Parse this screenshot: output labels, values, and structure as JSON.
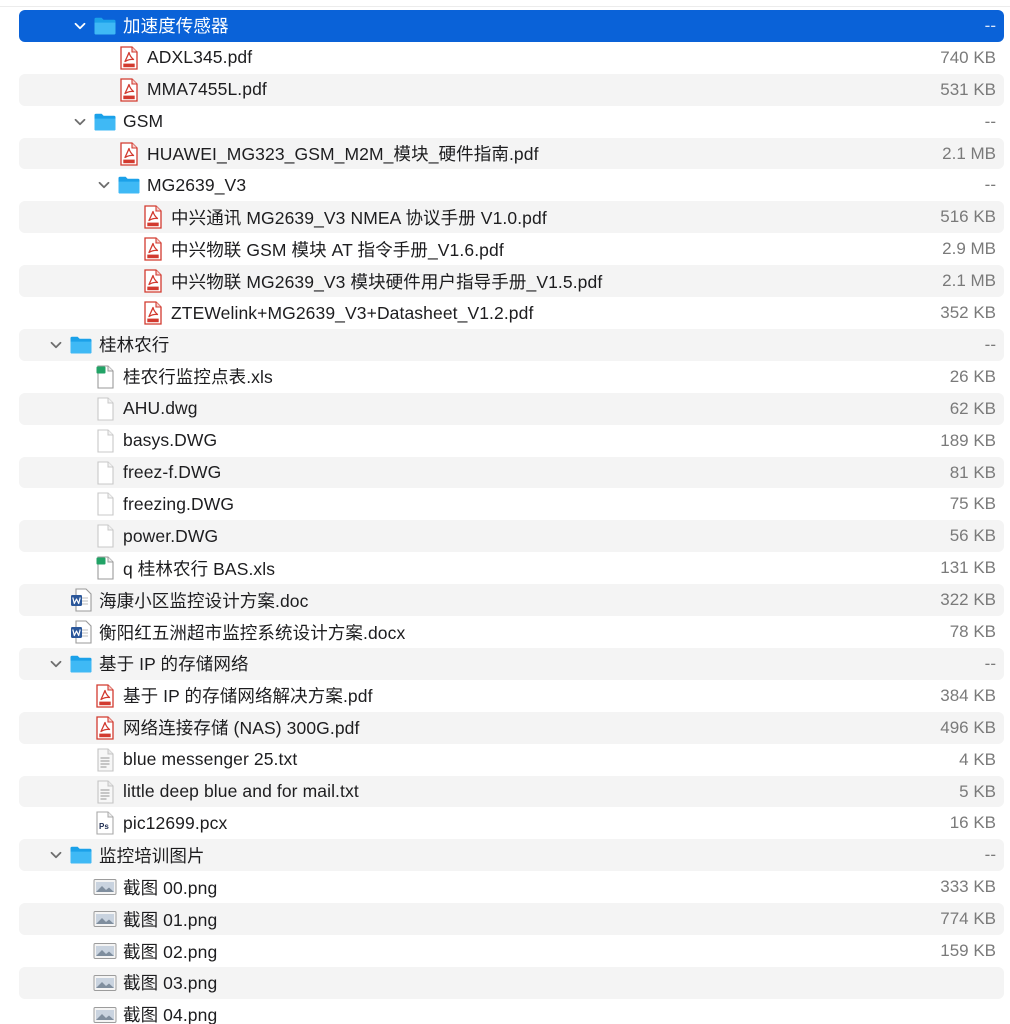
{
  "window": {
    "accent": "#0a62d8"
  },
  "rows": [
    {
      "depth": 2,
      "type": "folder",
      "expanded": true,
      "selected": true,
      "name": "加速度传感器",
      "size": "--"
    },
    {
      "depth": 3,
      "type": "pdf",
      "name": "ADXL345.pdf",
      "size": "740 KB"
    },
    {
      "depth": 3,
      "type": "pdf",
      "name": "MMA7455L.pdf",
      "size": "531 KB"
    },
    {
      "depth": 2,
      "type": "folder",
      "expanded": true,
      "name": "GSM",
      "size": "--"
    },
    {
      "depth": 3,
      "type": "pdf",
      "name": "HUAWEI_MG323_GSM_M2M_模块_硬件指南.pdf",
      "size": "2.1 MB"
    },
    {
      "depth": 3,
      "type": "folder",
      "expanded": true,
      "name": "MG2639_V3",
      "size": "--"
    },
    {
      "depth": 4,
      "type": "pdf",
      "name": "中兴通讯 MG2639_V3  NMEA 协议手册 V1.0.pdf",
      "size": "516 KB"
    },
    {
      "depth": 4,
      "type": "pdf",
      "name": "中兴物联 GSM 模块 AT 指令手册_V1.6.pdf",
      "size": "2.9 MB"
    },
    {
      "depth": 4,
      "type": "pdf",
      "name": "中兴物联 MG2639_V3 模块硬件用户指导手册_V1.5.pdf",
      "size": "2.1 MB"
    },
    {
      "depth": 4,
      "type": "pdf",
      "name": "ZTEWelink+MG2639_V3+Datasheet_V1.2.pdf",
      "size": "352 KB"
    },
    {
      "depth": 1,
      "type": "folder",
      "expanded": true,
      "name": "桂林农行",
      "size": "--"
    },
    {
      "depth": 2,
      "type": "xls",
      "name": "桂农行监控点表.xls",
      "size": "26 KB"
    },
    {
      "depth": 2,
      "type": "blank",
      "name": "AHU.dwg",
      "size": "62 KB"
    },
    {
      "depth": 2,
      "type": "blank",
      "name": "basys.DWG",
      "size": "189 KB"
    },
    {
      "depth": 2,
      "type": "blank",
      "name": "freez-f.DWG",
      "size": "81 KB"
    },
    {
      "depth": 2,
      "type": "blank",
      "name": "freezing.DWG",
      "size": "75 KB"
    },
    {
      "depth": 2,
      "type": "blank",
      "name": "power.DWG",
      "size": "56 KB"
    },
    {
      "depth": 2,
      "type": "xls",
      "name": "q 桂林农行 BAS.xls",
      "size": "131 KB"
    },
    {
      "depth": 1,
      "type": "doc",
      "name": "海康小区监控设计方案.doc",
      "size": "322 KB"
    },
    {
      "depth": 1,
      "type": "doc",
      "name": "衡阳红五洲超市监控系统设计方案.docx",
      "size": "78 KB"
    },
    {
      "depth": 1,
      "type": "folder",
      "expanded": true,
      "name": "基于 IP 的存储网络",
      "size": "--"
    },
    {
      "depth": 2,
      "type": "pdf",
      "name": "基于 IP 的存储网络解决方案.pdf",
      "size": "384 KB"
    },
    {
      "depth": 2,
      "type": "pdf",
      "name": "网络连接存储 (NAS) 300G.pdf",
      "size": "496 KB"
    },
    {
      "depth": 2,
      "type": "txt",
      "name": "blue messenger 25.txt",
      "size": "4 KB"
    },
    {
      "depth": 2,
      "type": "txt",
      "name": "little deep blue and for mail.txt",
      "size": "5 KB"
    },
    {
      "depth": 2,
      "type": "ps",
      "name": "pic12699.pcx",
      "size": "16 KB"
    },
    {
      "depth": 1,
      "type": "folder",
      "expanded": true,
      "name": "监控培训图片",
      "size": "--"
    },
    {
      "depth": 2,
      "type": "img",
      "name": "截图 00.png",
      "size": "333 KB"
    },
    {
      "depth": 2,
      "type": "img",
      "name": "截图 01.png",
      "size": "774 KB"
    },
    {
      "depth": 2,
      "type": "img",
      "name": "截图 02.png",
      "size": "159 KB"
    },
    {
      "depth": 2,
      "type": "img",
      "name": "截图 03.png",
      "size": ""
    },
    {
      "depth": 2,
      "type": "img",
      "name": "截图 04.png",
      "size": ""
    }
  ]
}
